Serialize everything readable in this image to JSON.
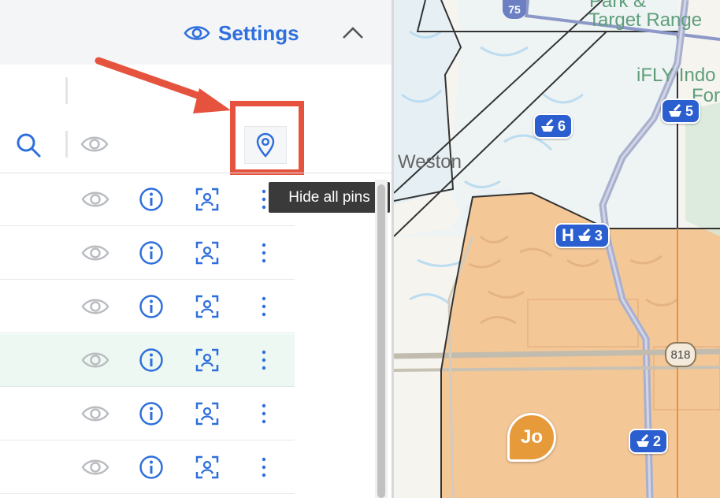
{
  "header": {
    "settings_label": "Settings"
  },
  "tooltip": {
    "text": "Hide all pins"
  },
  "rows": [
    {},
    {},
    {},
    {
      "highlighted": true
    },
    {},
    {}
  ],
  "map": {
    "labels": {
      "town": "Weston",
      "park": "Park &",
      "range": "Target Range",
      "ifly1": "iFLY Indo",
      "ifly2": "For"
    },
    "shields": {
      "i75": "75",
      "sr818": "818"
    },
    "badges": {
      "b6": "6",
      "b5": "5",
      "b3": "3",
      "b2": "2",
      "h": "H"
    },
    "avatar": "Jo"
  },
  "colors": {
    "accent": "#2f6fdd",
    "highlight_box": "#e5533f",
    "region_fill": "#f4c796",
    "badge": "#2b5fd0",
    "avatar": "#e69a3a"
  }
}
